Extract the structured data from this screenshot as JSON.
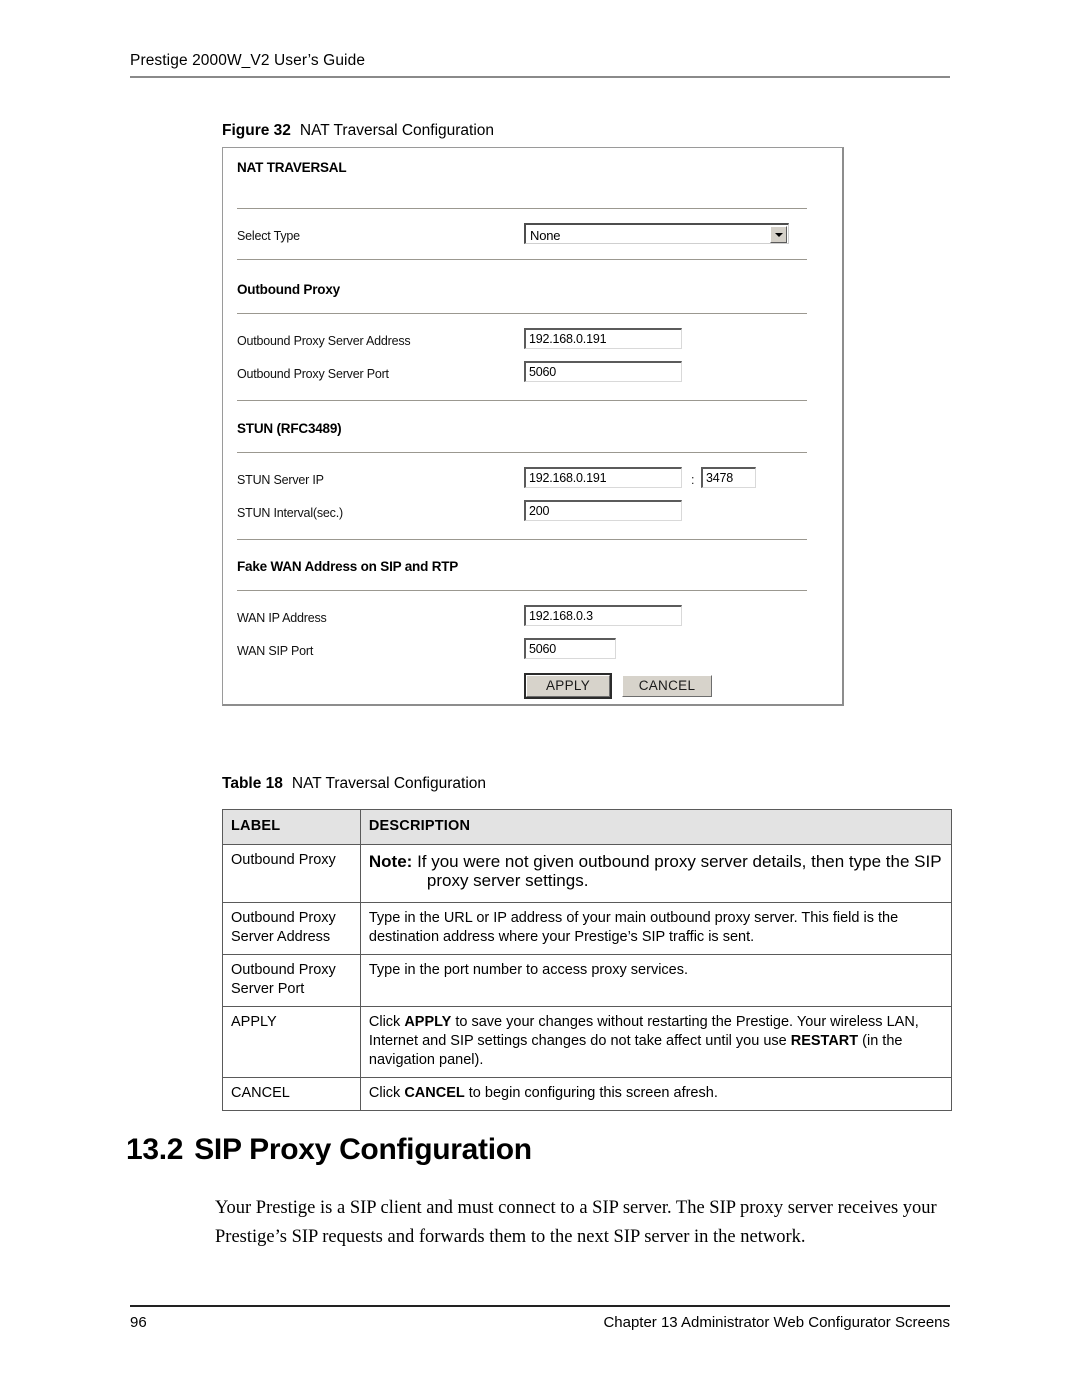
{
  "header": {
    "running_head": "Prestige 2000W_V2 User’s Guide"
  },
  "figure": {
    "caption_label": "Figure 32",
    "caption_text": "NAT Traversal Configuration",
    "screenshot": {
      "title": "NAT TRAVERSAL",
      "select_type": {
        "label": "Select Type",
        "value": "None",
        "arrow_icon": "chevron-down-icon"
      },
      "outbound_proxy": {
        "section_title": "Outbound Proxy",
        "server_address_label": "Outbound Proxy Server Address",
        "server_address_value": "192.168.0.191",
        "server_port_label": "Outbound Proxy Server Port",
        "server_port_value": "5060"
      },
      "stun": {
        "section_title": "STUN (RFC3489)",
        "server_ip_label": "STUN Server IP",
        "server_ip_value": "192.168.0.191",
        "separator": ":",
        "server_port_value": "3478",
        "interval_label": "STUN Interval(sec.)",
        "interval_value": "200"
      },
      "fake_wan": {
        "section_title": "Fake WAN Address on SIP and RTP",
        "wan_ip_label": "WAN IP Address",
        "wan_ip_value": "192.168.0.3",
        "wan_sip_port_label": "WAN SIP Port",
        "wan_sip_port_value": "5060"
      },
      "buttons": {
        "apply": "APPLY",
        "cancel": "CANCEL"
      }
    }
  },
  "table": {
    "caption_label": "Table 18",
    "caption_text": "NAT Traversal Configuration",
    "columns": [
      "LABEL",
      "DESCRIPTION"
    ],
    "rows": [
      {
        "label": "Outbound Proxy",
        "note_prefix": "Note:",
        "description": "If you were not given outbound proxy server details, then type the SIP proxy server settings."
      },
      {
        "label": "Outbound Proxy Server Address",
        "description": "Type in the URL or IP address of your main outbound proxy server. This field is the destination address where your Prestige’s SIP traffic is sent."
      },
      {
        "label": "Outbound Proxy Server Port",
        "description": "Type in the port number to access proxy services."
      },
      {
        "label": "APPLY",
        "description_parts": [
          {
            "text": "Click ",
            "bold": false
          },
          {
            "text": "APPLY",
            "bold": true
          },
          {
            "text": " to save your changes without restarting the Prestige. Your wireless LAN, Internet and SIP settings changes do not take affect until you use ",
            "bold": false
          },
          {
            "text": "RESTART",
            "bold": true
          },
          {
            "text": " (in the navigation panel).",
            "bold": false
          }
        ]
      },
      {
        "label": "CANCEL",
        "description_parts": [
          {
            "text": "Click ",
            "bold": false
          },
          {
            "text": "CANCEL",
            "bold": true
          },
          {
            "text": " to begin configuring this screen afresh.",
            "bold": false
          }
        ]
      }
    ]
  },
  "section": {
    "number": "13.2",
    "title": "SIP Proxy Configuration",
    "paragraph": "Your Prestige is a SIP client and must connect to a SIP server. The SIP proxy server receives your Prestige’s SIP requests and forwards them to the next SIP server in the network."
  },
  "footer": {
    "page_number": "96",
    "chapter": "Chapter 13 Administrator Web Configurator Screens"
  },
  "colors": {
    "table_header_bg": "#e3e3e3",
    "rule": "#8a8a8a",
    "button_face": "#d7d3cb"
  }
}
